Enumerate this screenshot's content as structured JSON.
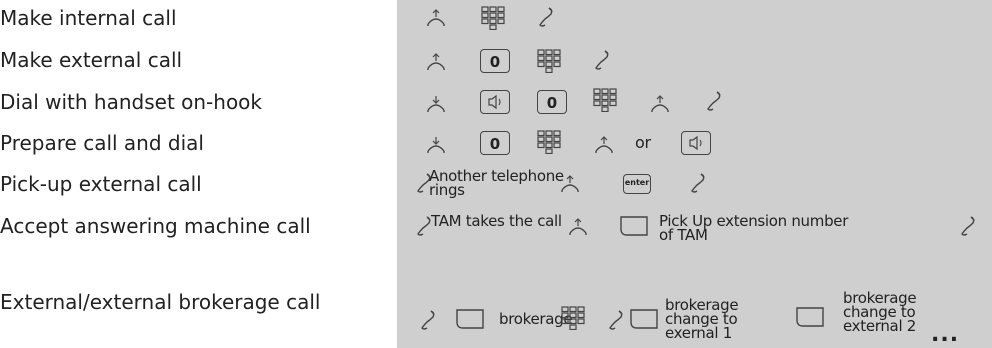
{
  "procedures": [
    {
      "label": "Make internal call"
    },
    {
      "label": "Make external call"
    },
    {
      "label": "Dial with handset on-hook"
    },
    {
      "label": "Prepare call and dial"
    },
    {
      "label": "Pick-up external call"
    },
    {
      "label": "Accept answering machine call"
    },
    {
      "label": "External/external brokerage call"
    }
  ],
  "keys": {
    "zero": "0",
    "enter": "enter"
  },
  "texts": {
    "or": "or",
    "another_phone_1": "Another telephone",
    "another_phone_2": "rings",
    "tam_takes": "TAM takes the call",
    "pickup_1": "Pick Up extension number",
    "pickup_2": "of TAM",
    "brokerage": "brokerage",
    "b2_1": "brokerage",
    "b2_2": "change to",
    "b2_3": "exernal 1",
    "b3_1": "brokerage",
    "b3_2": "change to",
    "b3_3": "external 2",
    "ellipsis": "..."
  },
  "icons": [
    "handset-lift-icon",
    "keypad-icon",
    "talk-icon",
    "zero-key",
    "speaker-key",
    "handset-hangup-icon",
    "enter-key",
    "function-key-icon"
  ]
}
